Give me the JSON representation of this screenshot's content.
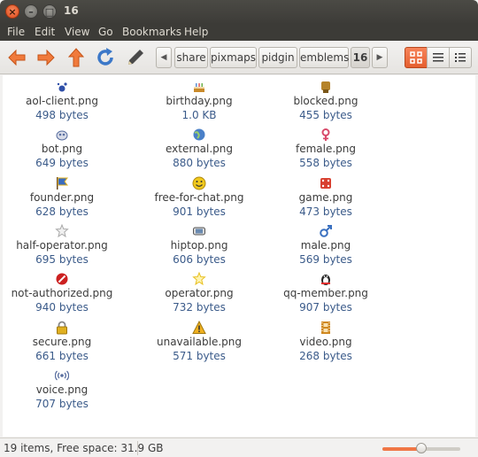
{
  "window": {
    "title": "16"
  },
  "menubar": [
    "File",
    "Edit",
    "View",
    "Go",
    "Bookmarks",
    "Help"
  ],
  "breadcrumb": [
    "share",
    "pixmaps",
    "pidgin",
    "emblems",
    "16"
  ],
  "files": [
    {
      "name": "aol-client.png",
      "size": "498 bytes",
      "icon": "aol-client-icon",
      "color": "#2f4fa8"
    },
    {
      "name": "birthday.png",
      "size": "1.0 KB",
      "icon": "birthday-cake-icon",
      "color": "#c98a2a"
    },
    {
      "name": "blocked.png",
      "size": "455 bytes",
      "icon": "blocked-icon",
      "color": "#b5832a"
    },
    {
      "name": "bot.png",
      "size": "649 bytes",
      "icon": "bot-icon",
      "color": "#5a6fa0"
    },
    {
      "name": "external.png",
      "size": "880 bytes",
      "icon": "external-globe-icon",
      "color": "#4a80c8"
    },
    {
      "name": "female.png",
      "size": "558 bytes",
      "icon": "female-icon",
      "color": "#d84a6a"
    },
    {
      "name": "founder.png",
      "size": "628 bytes",
      "icon": "founder-flag-icon",
      "color": "#3a6cc0"
    },
    {
      "name": "free-for-chat.png",
      "size": "901 bytes",
      "icon": "smiley-icon",
      "color": "#f0c81c"
    },
    {
      "name": "game.png",
      "size": "473 bytes",
      "icon": "game-dice-icon",
      "color": "#d84030"
    },
    {
      "name": "half-operator.png",
      "size": "695 bytes",
      "icon": "half-operator-star-icon",
      "color": "#a8a8a8"
    },
    {
      "name": "hiptop.png",
      "size": "606 bytes",
      "icon": "hiptop-device-icon",
      "color": "#555555"
    },
    {
      "name": "male.png",
      "size": "569 bytes",
      "icon": "male-icon",
      "color": "#3a70c0"
    },
    {
      "name": "not-authorized.png",
      "size": "940 bytes",
      "icon": "not-authorized-icon",
      "color": "#cc2020"
    },
    {
      "name": "operator.png",
      "size": "732 bytes",
      "icon": "operator-star-icon",
      "color": "#e8c020"
    },
    {
      "name": "qq-member.png",
      "size": "907 bytes",
      "icon": "qq-penguin-icon",
      "color": "#222222"
    },
    {
      "name": "secure.png",
      "size": "661 bytes",
      "icon": "lock-icon",
      "color": "#e0b020"
    },
    {
      "name": "unavailable.png",
      "size": "571 bytes",
      "icon": "warning-icon",
      "color": "#f0b020"
    },
    {
      "name": "video.png",
      "size": "268 bytes",
      "icon": "film-icon",
      "color": "#d08820"
    },
    {
      "name": "voice.png",
      "size": "707 bytes",
      "icon": "voice-waves-icon",
      "color": "#5a6fa0"
    }
  ],
  "statusbar": {
    "text": "19 items, Free space: 31.9 GB",
    "zoom_fraction": 0.5
  },
  "colors": {
    "accent": "#e55f2f",
    "size_text": "#3b5b8a"
  }
}
